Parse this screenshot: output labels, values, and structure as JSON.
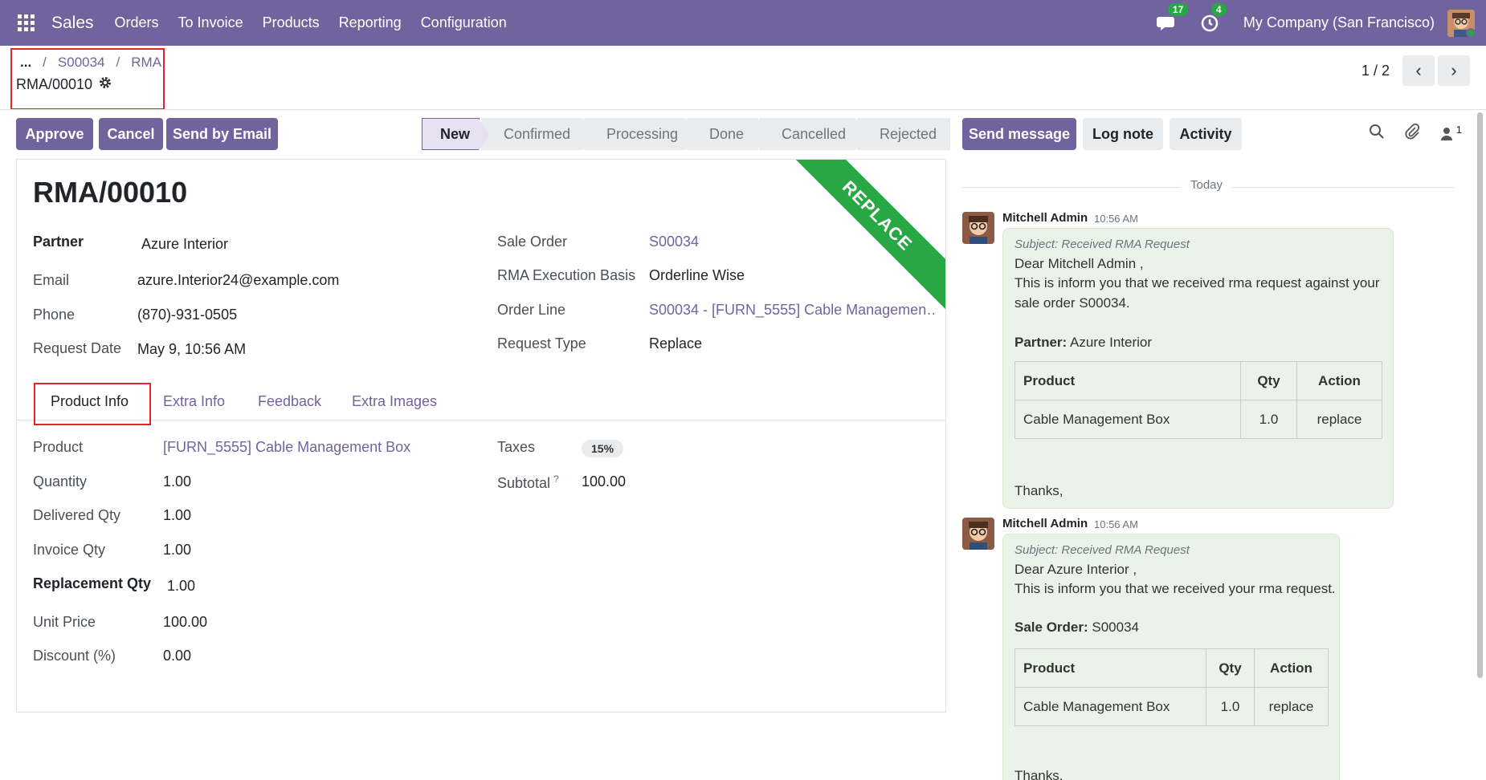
{
  "topnav": {
    "app_name": "Sales",
    "menu": [
      "Orders",
      "To Invoice",
      "Products",
      "Reporting",
      "Configuration"
    ],
    "messages_count": "17",
    "activities_count": "4",
    "company": "My Company (San Francisco)"
  },
  "breadcrumb": {
    "ellipsis": "...",
    "items": [
      "S00034",
      "RMA"
    ],
    "current": "RMA/00010"
  },
  "pager": {
    "value": "1 / 2"
  },
  "actions": {
    "approve": "Approve",
    "cancel": "Cancel",
    "send_email": "Send by Email"
  },
  "statusbar": {
    "stages": [
      "New",
      "Confirmed",
      "Processing",
      "Done",
      "Cancelled",
      "Rejected"
    ],
    "active": "New"
  },
  "ribbon": "REPLACE",
  "form": {
    "title": "RMA/00010",
    "left": [
      {
        "label": "Partner",
        "value": "Azure Interior"
      },
      {
        "label": "Email",
        "value": "azure.Interior24@example.com"
      },
      {
        "label": "Phone",
        "value": "(870)-931-0505"
      },
      {
        "label": "Request Date",
        "value": "May 9, 10:56 AM"
      }
    ],
    "right": [
      {
        "label": "Sale Order",
        "value": "S00034"
      },
      {
        "label": "RMA Execution Basis",
        "value": "Orderline Wise"
      },
      {
        "label": "Order Line",
        "value": "S00034 - [FURN_5555] Cable Managemen…"
      },
      {
        "label": "Request Type",
        "value": "Replace"
      }
    ],
    "tabs": [
      "Product Info",
      "Extra Info",
      "Feedback",
      "Extra Images"
    ],
    "product": [
      {
        "label": "Product",
        "value": "[FURN_5555] Cable Management Box"
      },
      {
        "label": "Quantity",
        "value": "1.00"
      },
      {
        "label": "Delivered Qty",
        "value": "1.00"
      },
      {
        "label": "Invoice Qty",
        "value": "1.00"
      },
      {
        "label": "Replacement Qty",
        "value": "1.00"
      },
      {
        "label": "Unit Price",
        "value": "100.00"
      },
      {
        "label": "Discount (%)",
        "value": "0.00"
      }
    ],
    "taxes_label": "Taxes",
    "taxes_value": "15%",
    "subtotal_label": "Subtotal",
    "subtotal_help": "?",
    "subtotal_value": "100.00"
  },
  "chatter": {
    "send_message": "Send message",
    "log_note": "Log note",
    "activity": "Activity",
    "followers_count": "1",
    "today": "Today",
    "messages": [
      {
        "author": "Mitchell Admin",
        "time": "10:56 AM",
        "subject": "Subject: Received RMA Request",
        "greeting": "Dear Mitchell Admin ,",
        "line1": "This is inform you that we received rma request against your",
        "line2": "sale order S00034.",
        "info_label": "Partner:",
        "info_value": "Azure Interior",
        "table_headers": [
          "Product",
          "Qty",
          "Action"
        ],
        "table_row": [
          "Cable Management Box",
          "1.0",
          "replace"
        ],
        "closing": "Thanks,"
      },
      {
        "author": "Mitchell Admin",
        "time": "10:56 AM",
        "subject": "Subject: Received RMA Request",
        "greeting": "Dear Azure Interior ,",
        "line1": "This is inform you that we received your rma request.",
        "info_label": "Sale Order:",
        "info_value": "S00034",
        "table_headers": [
          "Product",
          "Qty",
          "Action"
        ],
        "table_row": [
          "Cable Management Box",
          "1.0",
          "replace"
        ],
        "closing": "Thanks,"
      }
    ]
  }
}
